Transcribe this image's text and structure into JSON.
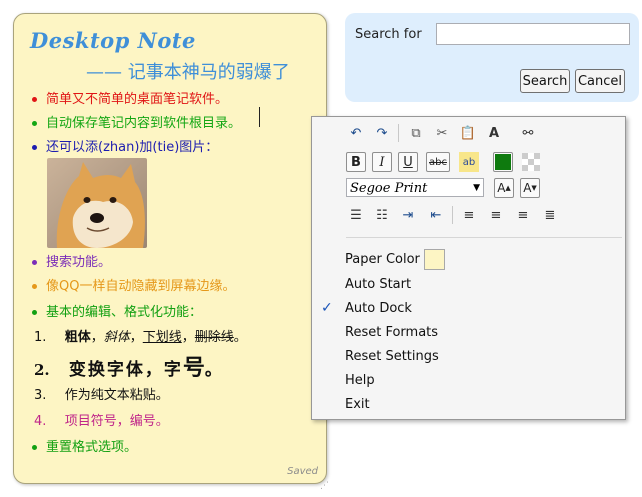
{
  "note": {
    "title": "Desktop Note",
    "subtitle": "—— 记事本神马的弱爆了",
    "bullets": [
      {
        "text": "简单又不简单的桌面笔记软件。",
        "color": "#e01515"
      },
      {
        "text": "自动保存笔记内容到软件根目录。",
        "color": "#13a613"
      },
      {
        "text": "还可以添(zhan)加(tie)图片：",
        "color": "#1d1db0"
      },
      {
        "text": "搜索功能。",
        "color": "#7b2eb8"
      },
      {
        "text": "像QQ一样自动隐藏到屏幕边缘。",
        "color": "#e5981a"
      },
      {
        "text": "基本的编辑、格式化功能：",
        "color": "#12a012"
      },
      {
        "text": "重置格式选项。",
        "color": "#12a012"
      }
    ],
    "sub_items": {
      "n1": "1.",
      "n2": "2.",
      "n3": "3.",
      "n4": "4.",
      "item1_bold": "粗体",
      "item1_sep1": "，",
      "item1_italic": "斜体",
      "item1_sep2": "，",
      "item1_underline": "下划线",
      "item1_sep3": "，",
      "item1_strike": "删除线",
      "item1_end": "。",
      "item2": "变换字体，字",
      "item2_big": "号",
      "item2_end": "。",
      "item3": "作为纯文本粘贴。",
      "item4": "项目符号，编号。"
    },
    "saved": "Saved"
  },
  "search": {
    "label": "Search for",
    "value": "",
    "search_button": "Search",
    "cancel_button": "Cancel"
  },
  "menu": {
    "font_name": "Segoe Print",
    "font_color": "#0e7a0e",
    "paper_color_label": "Paper Color",
    "paper_color": "#fdf5c4",
    "items": [
      "Auto Start",
      "Auto Dock",
      "Reset Formats",
      "Reset Settings",
      "Help",
      "Exit"
    ],
    "auto_dock_checked": true,
    "toolbar_icons": [
      "undo-icon",
      "redo-icon",
      "copy-icon",
      "cut-icon",
      "paste-icon",
      "paste-text-icon",
      "find-icon",
      "bold-icon",
      "italic-icon",
      "underline-icon",
      "strikethrough-icon",
      "highlight-icon",
      "font-color-icon",
      "clear-color-icon",
      "grow-font-icon",
      "shrink-font-icon",
      "bullets-icon",
      "numbering-icon",
      "indent-icon",
      "outdent-icon",
      "align-left-icon",
      "align-center-icon",
      "align-right-icon",
      "justify-icon"
    ]
  }
}
